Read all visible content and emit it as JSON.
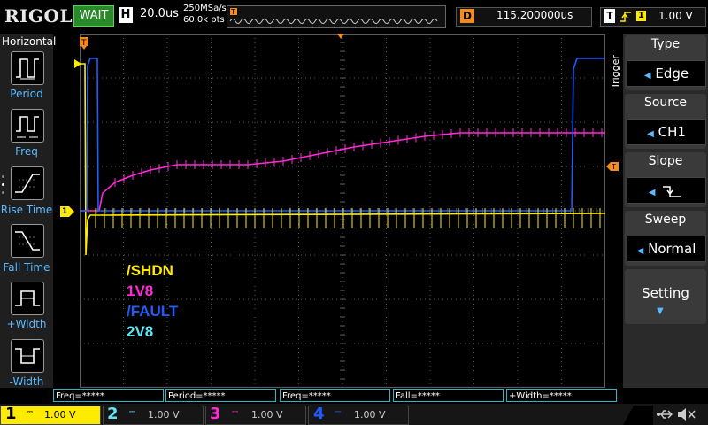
{
  "header": {
    "brand": "RIGOL",
    "run_state": "WAIT",
    "timebase_label": "H",
    "timebase_value": "20.0us",
    "sample_rate": "250MSa/s",
    "memory_depth": "60.0k pts",
    "delay_label": "D",
    "delay_value": "115.200000us",
    "trigger_label": "T",
    "trigger_channel": "1",
    "trigger_level": "1.00 V"
  },
  "horizontal_menu": {
    "title": "Horizontal",
    "items": [
      {
        "label": "Period",
        "icon": "period-icon"
      },
      {
        "label": "Freq",
        "icon": "freq-icon"
      },
      {
        "label": "Rise Time",
        "icon": "rise-time-icon"
      },
      {
        "label": "Fall Time",
        "icon": "fall-time-icon"
      },
      {
        "label": "+Width",
        "icon": "positive-width-icon"
      },
      {
        "label": "-Width",
        "icon": "negative-width-icon"
      }
    ]
  },
  "trigger_menu": {
    "side_label": "Trigger",
    "type_title": "Type",
    "type_value": "Edge",
    "source_title": "Source",
    "source_value": "CH1",
    "slope_title": "Slope",
    "sweep_title": "Sweep",
    "sweep_value": "Normal",
    "setting_label": "Setting"
  },
  "legend": {
    "items": [
      {
        "text": "/SHDN",
        "color": "#ffeb00"
      },
      {
        "text": "1V8",
        "color": "#ff2bd6"
      },
      {
        "text": "/FAULT",
        "color": "#1e5cff"
      },
      {
        "text": "2V8",
        "color": "#62e6f5"
      }
    ]
  },
  "markers": {
    "ch1_marker": "1"
  },
  "measurements": [
    "Freq=*****",
    "Period=*****",
    "Freq=*****",
    "Fall=*****",
    "+Width=*****"
  ],
  "channels": [
    {
      "num": "1",
      "scale": "1.00 V",
      "color": "#ffeb00"
    },
    {
      "num": "2",
      "scale": "1.00 V",
      "color": "#62e6f5"
    },
    {
      "num": "3",
      "scale": "1.00 V",
      "color": "#ff2bd6"
    },
    {
      "num": "4",
      "scale": "1.00 V",
      "color": "#1e5cff"
    }
  ],
  "colors": {
    "ch1": "#ffeb00",
    "ch2": "#62e6f5",
    "ch3": "#ff2bd6",
    "ch4": "#1e5cff",
    "grid": "#5a5a5a",
    "accent": "#5ab9ff",
    "trigger_orange": "#f58a1f"
  }
}
